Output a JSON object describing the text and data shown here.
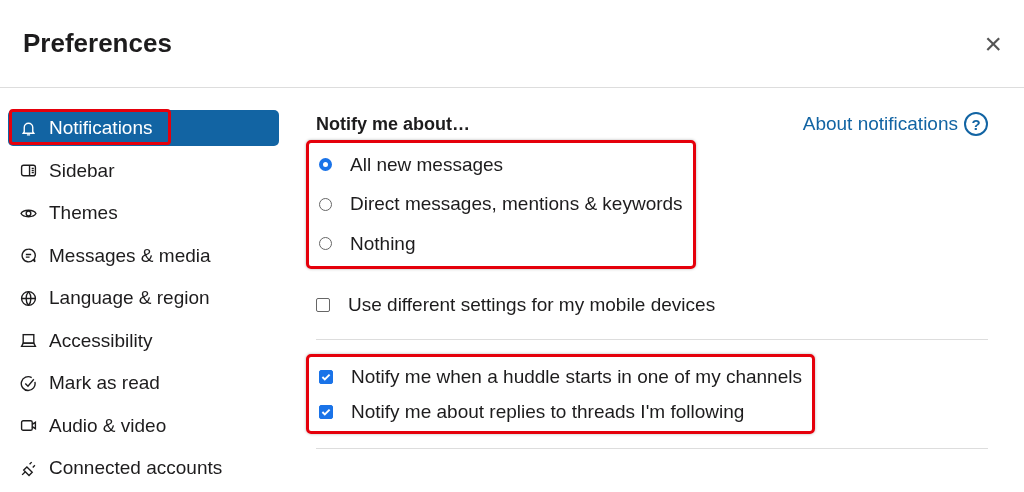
{
  "window": {
    "title": "Preferences",
    "close": "×"
  },
  "sidebar": {
    "items": [
      {
        "label": "Notifications",
        "kind": "bell",
        "selected": true,
        "highlighted": true
      },
      {
        "label": "Sidebar",
        "kind": "sidebar",
        "selected": false,
        "highlighted": false
      },
      {
        "label": "Themes",
        "kind": "eye",
        "selected": false,
        "highlighted": false
      },
      {
        "label": "Messages & media",
        "kind": "message",
        "selected": false,
        "highlighted": false
      },
      {
        "label": "Language & region",
        "kind": "globe",
        "selected": false,
        "highlighted": false
      },
      {
        "label": "Accessibility",
        "kind": "laptop",
        "selected": false,
        "highlighted": false
      },
      {
        "label": "Mark as read",
        "kind": "check",
        "selected": false,
        "highlighted": false
      },
      {
        "label": "Audio & video",
        "kind": "camera",
        "selected": false,
        "highlighted": false
      },
      {
        "label": "Connected accounts",
        "kind": "plug",
        "selected": false,
        "highlighted": false
      }
    ]
  },
  "content": {
    "heading": "Notify me about…",
    "help_link": "About notifications",
    "help_icon": "?",
    "notify_options": {
      "highlighted": true,
      "options": [
        {
          "label": "All new messages",
          "selected": true
        },
        {
          "label": "Direct messages, mentions & keywords",
          "selected": false
        },
        {
          "label": "Nothing",
          "selected": false
        }
      ]
    },
    "mobile_setting": {
      "label": "Use different settings for my mobile devices",
      "checked": false
    },
    "extra_options": {
      "highlighted": true,
      "options": [
        {
          "label": "Notify me when a huddle starts in one of my channels",
          "checked": true
        },
        {
          "label": "Notify me about replies to threads I'm following",
          "checked": true
        }
      ]
    }
  }
}
